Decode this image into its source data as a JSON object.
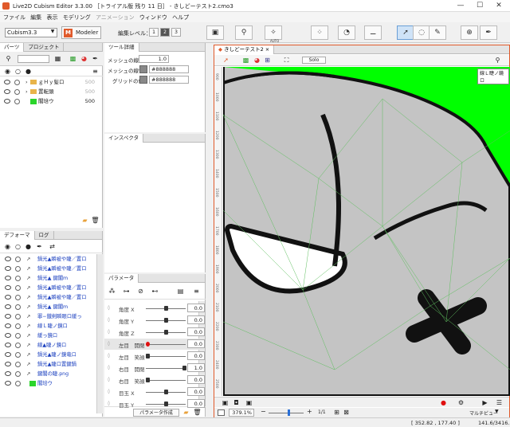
{
  "window": {
    "title": "Live2D Cubism Editor 3.3.00 ［トライアル版 残り 11 日］ - きしどーテスト2.cmo3",
    "minimize": "—",
    "maximize": "☐",
    "close": "✕"
  },
  "menu": [
    "ファイル",
    "編集",
    "表示",
    "モデリング",
    "アニメーション",
    "ウィンドウ",
    "ヘルプ"
  ],
  "toolbar": {
    "version_select": "Cubism3.3",
    "mode_badge": "M",
    "mode_label": "Modeler",
    "edit_level_label": "編集レベル：",
    "levels": [
      "1",
      "2",
      "3"
    ],
    "auto_label": "AUTO"
  },
  "parts_panel": {
    "tabs": [
      "パーツ",
      "プロジェクト"
    ],
    "items": [
      {
        "name": "ｇＨｙ髪ロ",
        "value": "500",
        "type": "folder"
      },
      {
        "name": "置転頭",
        "value": "500",
        "type": "folder"
      },
      {
        "name": "閣培ウ",
        "value": "500",
        "type": "part"
      }
    ]
  },
  "deformer_panel": {
    "tabs": [
      "デフォーマ",
      "ログ"
    ],
    "items": [
      "鍋光▲瞬被や睫／置ロ",
      "鍋光▲瞬被や睫／置ロ",
      "鍋光▲ 鍵閣m",
      "鍋光▲瞬被や睫／置ロ",
      "鍋光▲瞬被や睫／置ロ",
      "鍋光▲ 鍵閣m",
      "罪−鐡剣瞬眼ロ緩っ",
      "線Ｌ睫ノ鏡ロ",
      "緩っ鏡ロ",
      "線▲睫ノ鏡ロ",
      "鍋光▲睫ノ鏡竜ロ",
      "鍋光▲睫ロ置鍵鍋",
      "鍵閣の睫.png",
      "閣培ウ"
    ]
  },
  "tool_details": {
    "tab": "ツール詳細",
    "mesh_line_label": "メッシュの線幅",
    "mesh_line_value": "1.0",
    "mesh_line_color_label": "メッシュの線色",
    "mesh_line_color_value": "#888888",
    "grid_color_label": "グリッドの色",
    "grid_color_value": "#888888"
  },
  "inspector": {
    "tab": "インスペクタ"
  },
  "parameters": {
    "tab": "パラメータ",
    "create_button": "パラメータ作成",
    "items": [
      {
        "name": "角度 X",
        "value": "0.0",
        "knob": 0.5
      },
      {
        "name": "角度 Y",
        "value": "0.0",
        "knob": 0.5
      },
      {
        "name": "角度 Z",
        "value": "0.0",
        "knob": 0.5
      },
      {
        "name": "左目　開閉",
        "value": "0.0",
        "knob": 0.0,
        "selected": true
      },
      {
        "name": "左目　笑顔",
        "value": "0.0",
        "knob": 0.0
      },
      {
        "name": "右目　開閉",
        "value": "1.0",
        "knob": 1.0
      },
      {
        "name": "右目　笑顔",
        "value": "0.0",
        "knob": 0.0
      },
      {
        "name": "目玉 X",
        "value": "0.0",
        "knob": 0.5
      },
      {
        "name": "目玉 Y",
        "value": "0.0",
        "knob": 0.5
      }
    ]
  },
  "viewport": {
    "tab": "きしどーテスト2",
    "solo_button": "Solo",
    "selected_label": "線Ｌ睫ノ鏡ロ",
    "ruler_labels": [
      "900",
      "1000",
      "1100",
      "1200",
      "1300",
      "1400",
      "1500",
      "1600",
      "1700",
      "1800",
      "1900",
      "2000",
      "2100",
      "2200",
      "2300",
      "2400",
      "2500"
    ],
    "zoom_value": "379.1%",
    "page": "1/1",
    "view_label": "マルチビュー"
  },
  "status": {
    "coords": "[ 352.82 , 177.40 ]",
    "size": "141.6/3416.1"
  },
  "colors": {
    "accent": "#e05a2b",
    "background_green": "#00ff00",
    "mesh_gray": "#c4c4c4",
    "deformer_text": "#1a3fbf"
  }
}
